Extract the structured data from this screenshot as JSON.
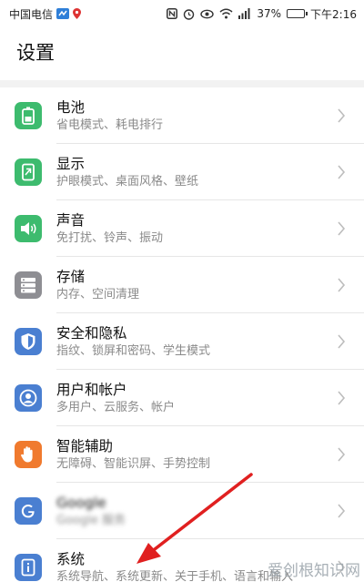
{
  "status": {
    "carrier": "中国电信",
    "battery": "37%",
    "time": "下午2:16",
    "battery_level": 0.37
  },
  "page_title": "设置",
  "items": [
    {
      "title": "电池",
      "subtitle": "省电模式、耗电排行",
      "icon": "battery-icon",
      "color": "#3dbb6e"
    },
    {
      "title": "显示",
      "subtitle": "护眼模式、桌面风格、壁纸",
      "icon": "display-icon",
      "color": "#3dbb6e"
    },
    {
      "title": "声音",
      "subtitle": "免打扰、铃声、振动",
      "icon": "speaker-icon",
      "color": "#3dbb6e"
    },
    {
      "title": "存储",
      "subtitle": "内存、空间清理",
      "icon": "storage-icon",
      "color": "#8e8e93"
    },
    {
      "title": "安全和隐私",
      "subtitle": "指纹、锁屏和密码、学生模式",
      "icon": "shield-icon",
      "color": "#4a7fd1"
    },
    {
      "title": "用户和帐户",
      "subtitle": "多用户、云服务、帐户",
      "icon": "user-icon",
      "color": "#4a7fd1"
    },
    {
      "title": "智能辅助",
      "subtitle": "无障碍、智能识屏、手势控制",
      "icon": "hand-icon",
      "color": "#f07a2e"
    },
    {
      "title": "Google",
      "subtitle": "Google 服务",
      "icon": "google-icon",
      "color": "#4a7fd1"
    },
    {
      "title": "系统",
      "subtitle": "系统导航、系统更新、关于手机、语言和输入",
      "icon": "system-icon",
      "color": "#4a7fd1"
    }
  ],
  "watermark": "爱创根知识网"
}
